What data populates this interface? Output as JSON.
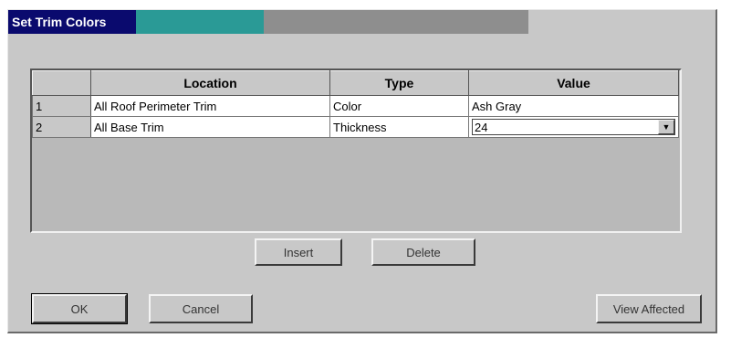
{
  "dialog": {
    "title": "Set Trim Colors"
  },
  "grid": {
    "columns": [
      "Location",
      "Type",
      "Value"
    ],
    "rows": [
      {
        "num": "1",
        "location": "All Roof Perimeter Trim",
        "type": "Color",
        "value": "Ash Gray"
      },
      {
        "num": "2",
        "location": "All Base Trim",
        "type": "Thickness",
        "value": "24"
      }
    ]
  },
  "buttons": {
    "insert": "Insert",
    "delete": "Delete",
    "ok": "OK",
    "cancel": "Cancel",
    "view_affected": "View Affected"
  },
  "icons": {
    "dropdown": "chevron-down-icon"
  }
}
